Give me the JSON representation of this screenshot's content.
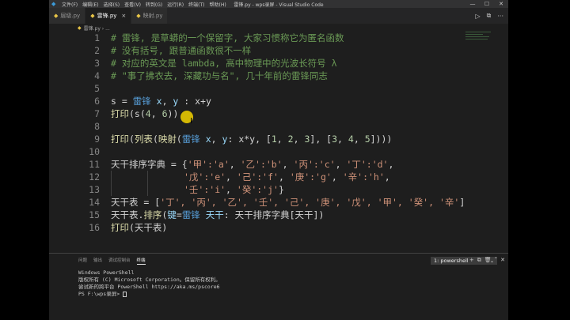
{
  "titlebar": {
    "menu": [
      "文件(F)",
      "编辑(E)",
      "选择(S)",
      "查看(V)",
      "转到(G)",
      "运行(R)",
      "终端(T)",
      "帮助(H)"
    ],
    "title": "雷锋.py - wps录屏 - Visual Studio Code",
    "min": "—",
    "max": "☐",
    "close": "✕"
  },
  "tabs": [
    {
      "label": "层级.py"
    },
    {
      "label": "雷锋.py"
    },
    {
      "label": "映射.py"
    }
  ],
  "tab_close": "×",
  "toolbar": {
    "run": "▷",
    "split": "⧉",
    "more": "···"
  },
  "breadcrumb": "雷锋.py › ...",
  "editor": {
    "line_numbers": [
      "1",
      "2",
      "3",
      "4",
      "5",
      "6",
      "7",
      "8",
      "9",
      "10",
      "11",
      "12",
      "13",
      "14",
      "15",
      "16"
    ],
    "lines": {
      "l1": "# 雷锋, 是草蟒的一个保留字, 大家习惯称它为匿名函数",
      "l2": "# 没有括号, 跟普通函数很不一样",
      "l3": "# 对应的英文是 lambda, 高中物理中的光波长符号 λ",
      "l4": "# \"事了拂衣去, 深藏功与名\", 几十年前的雷锋同志",
      "l6a": "s = ",
      "l6b": "雷锋",
      "l6c": " x",
      "l6d": ", ",
      "l6e": "y",
      "l6f": " : x+y",
      "l7a": "打印",
      "l7b": "(s(",
      "l7c": "4",
      "l7d": ", ",
      "l7e": "6",
      "l7f": "))",
      "l9a": "打印",
      "l9b": "(",
      "l9c": "列表",
      "l9d": "(",
      "l9e": "映射",
      "l9f": "(",
      "l9g": "雷锋",
      "l9h": " x",
      "l9i": ", ",
      "l9j": "y",
      "l9k": ": x*y, [",
      "l9l": "1",
      "l9m": ", ",
      "l9n": "2",
      "l9o": ", ",
      "l9p": "3",
      "l9q": "], [",
      "l9r": "3",
      "l9s": ", ",
      "l9t": "4",
      "l9u": ", ",
      "l9v": "5",
      "l9w": "])))",
      "l11a": "天干排序字典 = {",
      "l11b": "'甲':'a'",
      "l11c": ", ",
      "l11d": "'乙':'b'",
      "l11e": ", ",
      "l11f": "'丙':'c'",
      "l11g": ", ",
      "l11h": "'丁':'d'",
      "l11i": ",",
      "l12a": "'戊':'e'",
      "l12b": ", ",
      "l12c": "'己':'f'",
      "l12d": ", ",
      "l12e": "'庚':'g'",
      "l12f": ", ",
      "l12g": "'辛':'h'",
      "l12h": ",",
      "l13a": "'壬':'i'",
      "l13b": ", ",
      "l13c": "'癸':'j'",
      "l13d": "}",
      "l14a": "天干表 = [",
      "l14b": "'丁', '丙', '乙', '壬', '己', '庚', '戊', '甲', '癸', '辛'",
      "l14c": "]",
      "l15a": "天干表.",
      "l15b": "排序",
      "l15c": "(",
      "l15d": "键",
      "l15e": "=",
      "l15f": "雷锋",
      "l15g": " 天干",
      "l15h": ": 天干排序字典[天干])",
      "l16a": "打印",
      "l16b": "(天干表)"
    }
  },
  "panel": {
    "tabs": [
      "问题",
      "输出",
      "调试控制台",
      "终端"
    ],
    "active_tab": "终端",
    "select": "1: powershell",
    "select_chevron": "⌄",
    "icons": {
      "add": "+",
      "split": "⧉",
      "trash": "🗑",
      "up": "˄",
      "close": "✕"
    },
    "terminal": [
      "Windows PowerShell",
      "版权所有 (C) Microsoft Corporation。保留所有权利。",
      "",
      "尝试新的跨平台 PowerShell https://aka.ms/pscore6",
      "",
      "PS F:\\wps录屏> "
    ]
  },
  "colors": {
    "comment": "#6a9955",
    "keyword": "#569cd6",
    "function": "#dcdcaa",
    "number": "#b5cea8",
    "string": "#ce9178",
    "cursor_highlight": "#f5d400"
  }
}
